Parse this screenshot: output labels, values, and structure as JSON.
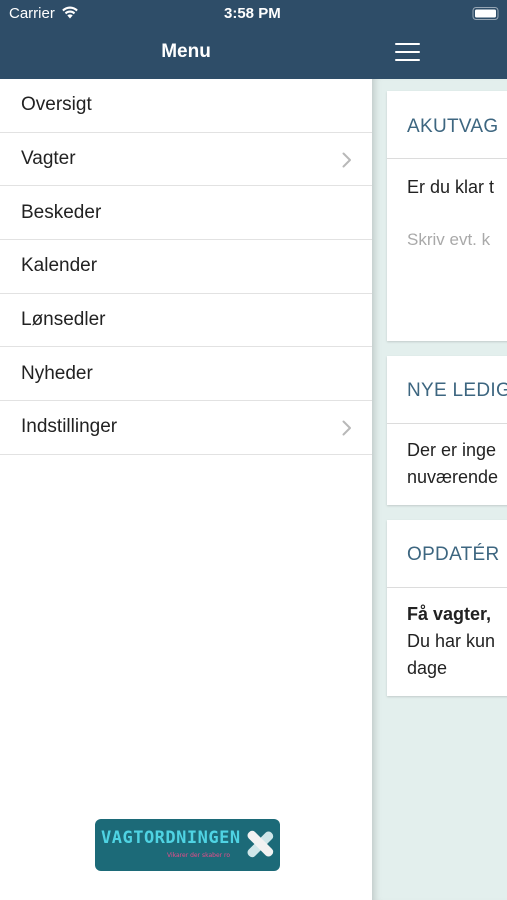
{
  "status_bar": {
    "carrier": "Carrier",
    "time": "3:58 PM"
  },
  "menu": {
    "title": "Menu",
    "items": [
      {
        "label": "Oversigt",
        "has_chevron": false
      },
      {
        "label": "Vagter",
        "has_chevron": true
      },
      {
        "label": "Beskeder",
        "has_chevron": false
      },
      {
        "label": "Kalender",
        "has_chevron": false
      },
      {
        "label": "Lønsedler",
        "has_chevron": false
      },
      {
        "label": "Nyheder",
        "has_chevron": false
      },
      {
        "label": "Indstillinger",
        "has_chevron": true
      }
    ],
    "logo": {
      "text": "VAGTORDNINGEN",
      "tagline": "Vikarer der skaber ro"
    }
  },
  "main": {
    "hamburger_icon": "hamburger-icon",
    "cards": {
      "akutvagt": {
        "title": "AKUTVAG",
        "text": "Er du klar t",
        "placeholder": "Skriv evt. k"
      },
      "nye": {
        "title": "NYE LEDIG",
        "line1": "Der er inge",
        "line2": "nuværende"
      },
      "opdater": {
        "title": "OPDATÉR",
        "bold": "Få vagter,",
        "line1": "Du har kun",
        "line2": "dage"
      }
    }
  },
  "colors": {
    "header": "#2e4d68",
    "content_bg": "#e3efed",
    "card_title": "#3d6680",
    "logo_bg": "#1c6a78"
  }
}
